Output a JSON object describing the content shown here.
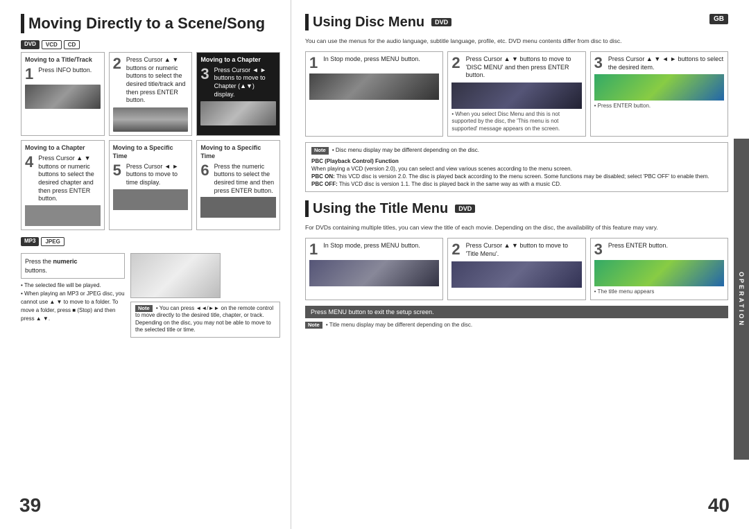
{
  "left_page": {
    "title": "Moving Directly to a Scene/Song",
    "page_number": "39",
    "disc_tags": [
      "DVD",
      "VCD",
      "CD"
    ],
    "section1_title": "Moving to a Title/Track",
    "section2_title": "Moving to a Chapter",
    "step1": {
      "num": "1",
      "text": "Press INFO button."
    },
    "step2": {
      "num": "2",
      "text": "Press Cursor ▲ ▼ buttons or numeric buttons to select the desired title/track and then press ENTER button."
    },
    "step3": {
      "num": "3",
      "text": "Press Cursor ◄ ► buttons to move to Chapter (▲▼) display."
    },
    "step4": {
      "num": "4",
      "text": "Press Cursor ▲ ▼ buttons or numeric buttons to select the desired chapter and then press ENTER button."
    },
    "step5": {
      "num": "5",
      "text": "Press Cursor ◄ ► buttons to move to time display."
    },
    "step6": {
      "num": "6",
      "text": "Press the numeric buttons to select the desired time and then press ENTER button."
    },
    "section3_title": "Moving to a Chapter",
    "section4_title": "Moving to a Specific Time",
    "section5_title": "Moving to a Specific Time",
    "mp3_tags": [
      "MP3",
      "JPEG"
    ],
    "mp3_step": "Press the numeric buttons.",
    "mp3_note_bullets": [
      "The selected file will be played.",
      "When playing an MP3 or JPEG disc, you cannot use ▲ ▼ to move to a folder. To move a folder, press ■ (Stop) and then press ▲ ▼."
    ],
    "note_label": "Note",
    "note_text": "• You can press ◄◄/►► on the remote control to move directly to the desired title, chapter, or track. Depending on the disc, you may not be able to move to the selected title or time."
  },
  "right_page": {
    "page_number": "40",
    "badge_gb": "GB",
    "section1_title": "Using Disc Menu",
    "section1_badge": "DVD",
    "section1_intro": "You can use the menus for the audio language, subtitle language, profile, etc. DVD menu contents differ from disc to disc.",
    "disc_step1": {
      "num": "1",
      "text": "In Stop mode, press MENU button."
    },
    "disc_step2": {
      "num": "2",
      "text": "Press Cursor ▲ ▼ buttons to move to 'DISC MENU' and then press ENTER button."
    },
    "disc_step3": {
      "num": "3",
      "text": "Press Cursor ▲ ▼ ◄ ► buttons to select the desired item."
    },
    "disc_note_label": "Note",
    "disc_note_text": "• Disc menu display may be different depending on the disc.",
    "disc_press_enter": "• Press ENTER button.",
    "disc_vcd_note": "• When you select Disc Menu and this is not supported by the disc, the 'This menu is not supported' message appears on the screen.",
    "pbc_title": "PBC (Playback Control) Function",
    "pbc_text": "When playing a VCD (version 2.0), you can select and view various scenes according to the menu screen.",
    "pbc_on": "PBC ON: This VCD disc is version 2.0. The disc is played back according to the menu screen. Some functions may be disabled; select 'PBC OFF' to enable them.",
    "pbc_off": "PBC OFF: This VCD disc is version 1.1. The disc is played back in the same way as with a music CD.",
    "operation_label": "OPERATION",
    "section2_title": "Using the Title Menu",
    "section2_badge": "DVD",
    "section2_intro": "For DVDs containing multiple titles, you can view the title of each movie. Depending on the disc, the availability of this feature may vary.",
    "title_step1": {
      "num": "1",
      "text": "In Stop mode, press MENU button."
    },
    "title_step2": {
      "num": "2",
      "text": "Press Cursor ▲ ▼ button to move to 'Title Menu'."
    },
    "title_step3": {
      "num": "3",
      "text": "Press ENTER button."
    },
    "title_note": "• The title menu appears",
    "bottom_bar_text": "Press MENU button to exit the setup screen.",
    "bottom_note": "• Title menu display may be different depending on the disc.",
    "note_label": "Note"
  }
}
